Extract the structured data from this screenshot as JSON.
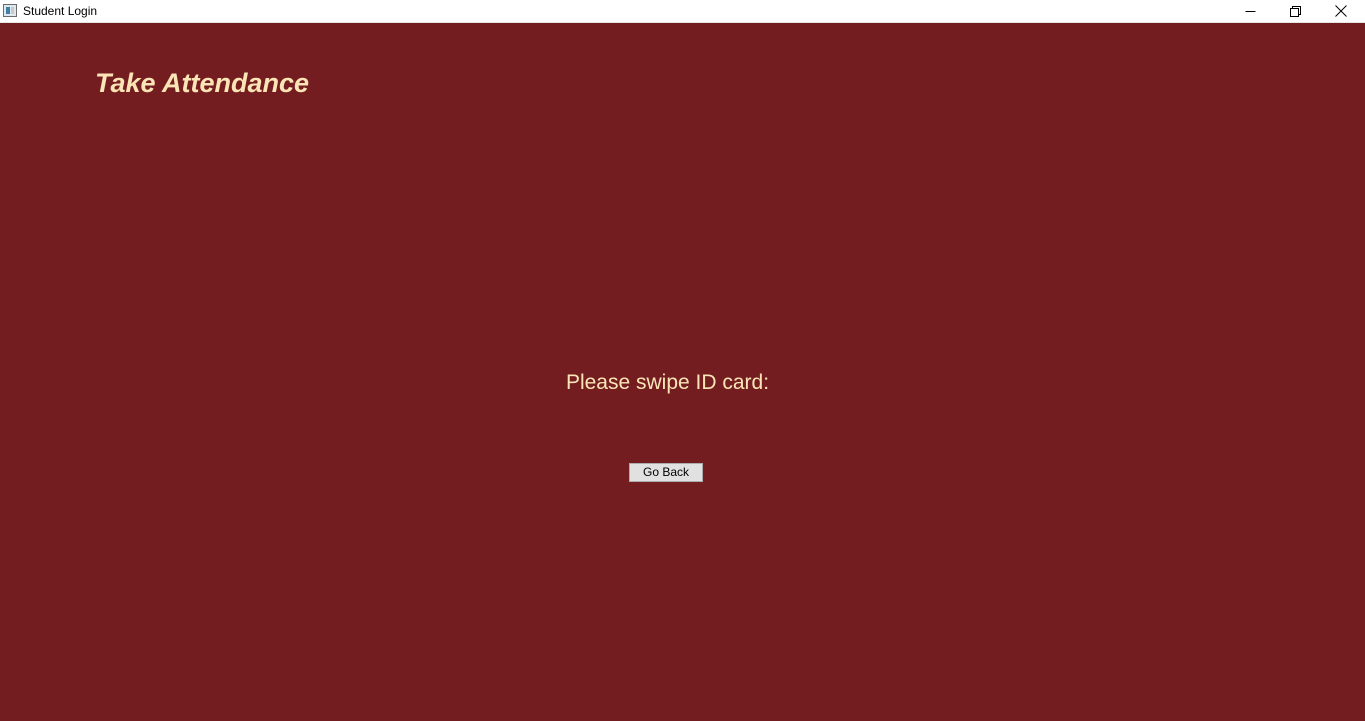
{
  "window": {
    "title": "Student Login",
    "icon": "app-window-icon",
    "controls": {
      "minimize_icon": "minimize-icon",
      "restore_icon": "restore-icon",
      "close_icon": "close-icon"
    }
  },
  "main": {
    "heading": "Take Attendance",
    "prompt": "Please swipe ID card:",
    "go_back_label": "Go Back"
  },
  "colors": {
    "background": "#731d21",
    "text_accent": "#fbe5b6",
    "button_face": "#e1e1e1",
    "button_border": "#adadad"
  }
}
